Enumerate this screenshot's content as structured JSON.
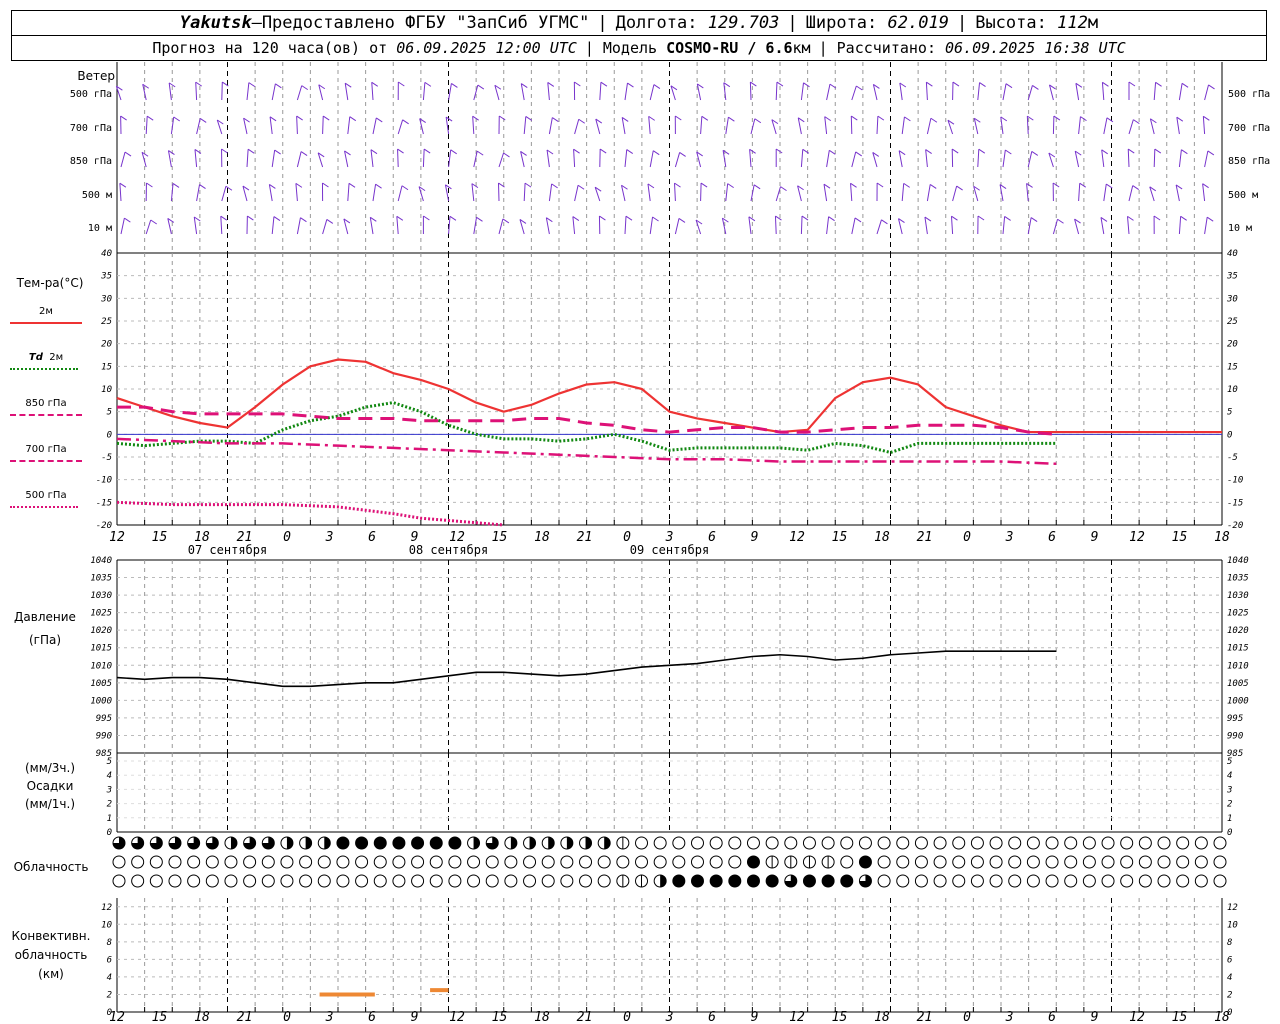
{
  "header": {
    "station": "Yakutsk",
    "dash": " — ",
    "provider": "Предоставлено ФГБУ \"ЗапСиб УГМС\"",
    "lon_label": "Долгота:",
    "lon": "129.703",
    "lat_label": "Широта:",
    "lat": "62.019",
    "alt_label": "Высота:",
    "alt": "112",
    "alt_unit": "м",
    "forecast_prefix": "Прогноз на 120 часа(ов) от",
    "forecast_start": "06.09.2025 12:00 UTC",
    "model_label": "Модель",
    "model": "COSMO-RU / 6.6",
    "model_unit": "км",
    "calc_label": "Рассчитано:",
    "calc_time": "06.09.2025 16:38 UTC"
  },
  "labels": {
    "wind": "Ветер",
    "wind_levels": [
      "500 гПа",
      "700 гПа",
      "850 гПа",
      "500 м",
      "10 м"
    ],
    "temp_title": "Тем-ра(°C)",
    "t2m": "2м",
    "td": "Td",
    "td2m": "2м",
    "t850": "850 гПа",
    "t700": "700 гПа",
    "t500": "500 гПа",
    "pressure_title": "Давление",
    "pressure_unit": "(гПа)",
    "precip_unit3": "(мм/3ч.)",
    "precip_title": "Осадки",
    "precip_unit1": "(мм/1ч.)",
    "cloud_title": "Облачность",
    "conv_line1": "Конвективн.",
    "conv_line2": "облачность",
    "conv_line3": "(км)"
  },
  "colors": {
    "t2m": "#ee3333",
    "td": "#118811",
    "t850": "#dd1177",
    "t700": "#dd1177",
    "t500": "#dd1177",
    "wind": "#7733cc",
    "conv": "#ee8833",
    "zero_line": "#3333cc"
  },
  "time_axis": {
    "hour_ticks": [
      "12",
      "15",
      "18",
      "21",
      "0",
      "3",
      "6",
      "9",
      "12",
      "15",
      "18",
      "21",
      "0",
      "3",
      "6",
      "9",
      "12",
      "15",
      "18",
      "21",
      "0",
      "3",
      "6",
      "9",
      "12",
      "15",
      "18"
    ],
    "day_labels": [
      "07 сентября",
      "08 сентября",
      "09 сентября"
    ]
  },
  "chart_data": [
    {
      "type": "line",
      "title": "Тем-ра(°C)",
      "x_unit": "hours since 06.09.2025 12:00 UTC",
      "ylim": [
        -20,
        40
      ],
      "yticks": [
        -20,
        -15,
        -10,
        -5,
        0,
        5,
        10,
        15,
        20,
        25,
        30,
        35,
        40
      ],
      "series": [
        {
          "name": "2м",
          "style": "solid",
          "x": [
            0,
            3,
            6,
            9,
            12,
            15,
            18,
            21,
            24,
            27,
            30,
            33,
            36,
            39,
            42,
            45,
            48,
            51,
            54,
            57,
            60,
            63,
            66,
            69,
            72,
            75,
            78,
            81,
            84,
            87,
            90,
            93,
            96,
            99,
            102,
            105,
            108,
            111,
            114,
            117,
            120
          ],
          "y": [
            8,
            6,
            4,
            2.5,
            1.5,
            6,
            11,
            15,
            16.5,
            16,
            13.5,
            12,
            10,
            7,
            5,
            6.5,
            9,
            11,
            11.5,
            10,
            5,
            3.5,
            2.5,
            1.5,
            0.5,
            1,
            8,
            11.5,
            12.5,
            11,
            6,
            4,
            2,
            0.5,
            0.5,
            0.5,
            0.5,
            0.5,
            0.5,
            0.5,
            0.5
          ]
        },
        {
          "name": "Td 2м",
          "style": "dotted",
          "x": [
            0,
            3,
            6,
            9,
            12,
            15,
            18,
            21,
            24,
            27,
            30,
            33,
            36,
            39,
            42,
            45,
            48,
            51,
            54,
            57,
            60,
            63,
            66,
            69,
            72,
            75,
            78,
            81,
            84,
            87,
            90,
            93,
            96,
            99,
            102
          ],
          "y": [
            -2,
            -2.5,
            -2,
            -1.5,
            -1.5,
            -2,
            1,
            3,
            4,
            6,
            7,
            5,
            2,
            0,
            -1,
            -1,
            -1.5,
            -1,
            0,
            -1.5,
            -3.5,
            -3,
            -3,
            -3,
            -3,
            -3.5,
            -2,
            -2.5,
            -4,
            -2,
            -2,
            -2,
            -2,
            -2,
            -2
          ]
        },
        {
          "name": "850 гПа",
          "style": "dashed",
          "x": [
            0,
            3,
            6,
            9,
            12,
            15,
            18,
            21,
            24,
            27,
            30,
            33,
            36,
            39,
            42,
            45,
            48,
            51,
            54,
            57,
            60,
            63,
            66,
            69,
            72,
            75,
            78,
            81,
            84,
            87,
            90,
            93,
            96,
            99,
            102
          ],
          "y": [
            6,
            6,
            5,
            4.5,
            4.5,
            4.5,
            4.5,
            4,
            3.5,
            3.5,
            3.5,
            3,
            3,
            3,
            3,
            3.5,
            3.5,
            2.5,
            2,
            1,
            0.5,
            1,
            1.5,
            1.5,
            0.5,
            0.5,
            1,
            1.5,
            1.5,
            2,
            2,
            2,
            1.5,
            0.5,
            0
          ]
        },
        {
          "name": "700 гПа",
          "style": "dashdot",
          "x": [
            0,
            6,
            12,
            18,
            24,
            30,
            36,
            42,
            48,
            54,
            60,
            66,
            72,
            78,
            84,
            90,
            96,
            102
          ],
          "y": [
            -1,
            -1.5,
            -2,
            -2,
            -2.5,
            -3,
            -3.5,
            -4,
            -4.5,
            -5,
            -5.5,
            -5.5,
            -6,
            -6,
            -6,
            -6,
            -6,
            -6.5
          ]
        },
        {
          "name": "500 гПа",
          "style": "densedot",
          "x": [
            0,
            6,
            12,
            18,
            24,
            30,
            33,
            36,
            39,
            42
          ],
          "y": [
            -15,
            -15.5,
            -15.5,
            -15.5,
            -16,
            -17.5,
            -18.5,
            -19,
            -19.5,
            -20
          ]
        }
      ]
    },
    {
      "type": "line",
      "title": "Давление",
      "ylabel": "(гПа)",
      "x_unit": "hours since 06.09.2025 12:00 UTC",
      "ylim": [
        985,
        1040
      ],
      "yticks": [
        985,
        990,
        995,
        1000,
        1005,
        1010,
        1015,
        1020,
        1025,
        1030,
        1035,
        1040
      ],
      "series": [
        {
          "name": "Давление",
          "x": [
            0,
            3,
            6,
            9,
            12,
            15,
            18,
            21,
            24,
            27,
            30,
            33,
            36,
            39,
            42,
            45,
            48,
            51,
            54,
            57,
            60,
            63,
            66,
            69,
            72,
            75,
            78,
            81,
            84,
            87,
            90,
            93,
            96,
            99,
            102
          ],
          "y": [
            1006.5,
            1006,
            1006.5,
            1006.5,
            1006,
            1005,
            1004,
            1004,
            1004.5,
            1005,
            1005,
            1006,
            1007,
            1008,
            1008,
            1007.5,
            1007,
            1007.5,
            1008.5,
            1009.5,
            1010,
            1010.5,
            1011.5,
            1012.5,
            1013,
            1012.5,
            1011.5,
            1012,
            1013,
            1013.5,
            1014,
            1014,
            1014,
            1014,
            1014
          ]
        }
      ]
    },
    {
      "type": "bar",
      "title": "Осадки",
      "ylim": [
        0,
        5
      ],
      "yticks": [
        0,
        1,
        2,
        3,
        4,
        5
      ],
      "values": []
    },
    {
      "type": "bar",
      "title": "Конвективн. облачность (км)",
      "ylim": [
        0,
        13
      ],
      "yticks": [
        0,
        2,
        4,
        6,
        8,
        10,
        12
      ],
      "segments": [
        {
          "x_start": 22,
          "x_end": 28,
          "y": 2
        },
        {
          "x_start": 34,
          "x_end": 36,
          "y": 2.5
        }
      ]
    }
  ],
  "clouds": {
    "rows": [
      "ddddddcddcccfffffffcdccccccb000000000000000000000000000000000000000000000000000000000",
      "0000000000000000000000000000000000fbbbb0f000000000000000000000000000000000000000000000000",
      "000000000000000000000000000bbcffffffdfffd0000000000000000000000000000000000000000000"
    ]
  }
}
